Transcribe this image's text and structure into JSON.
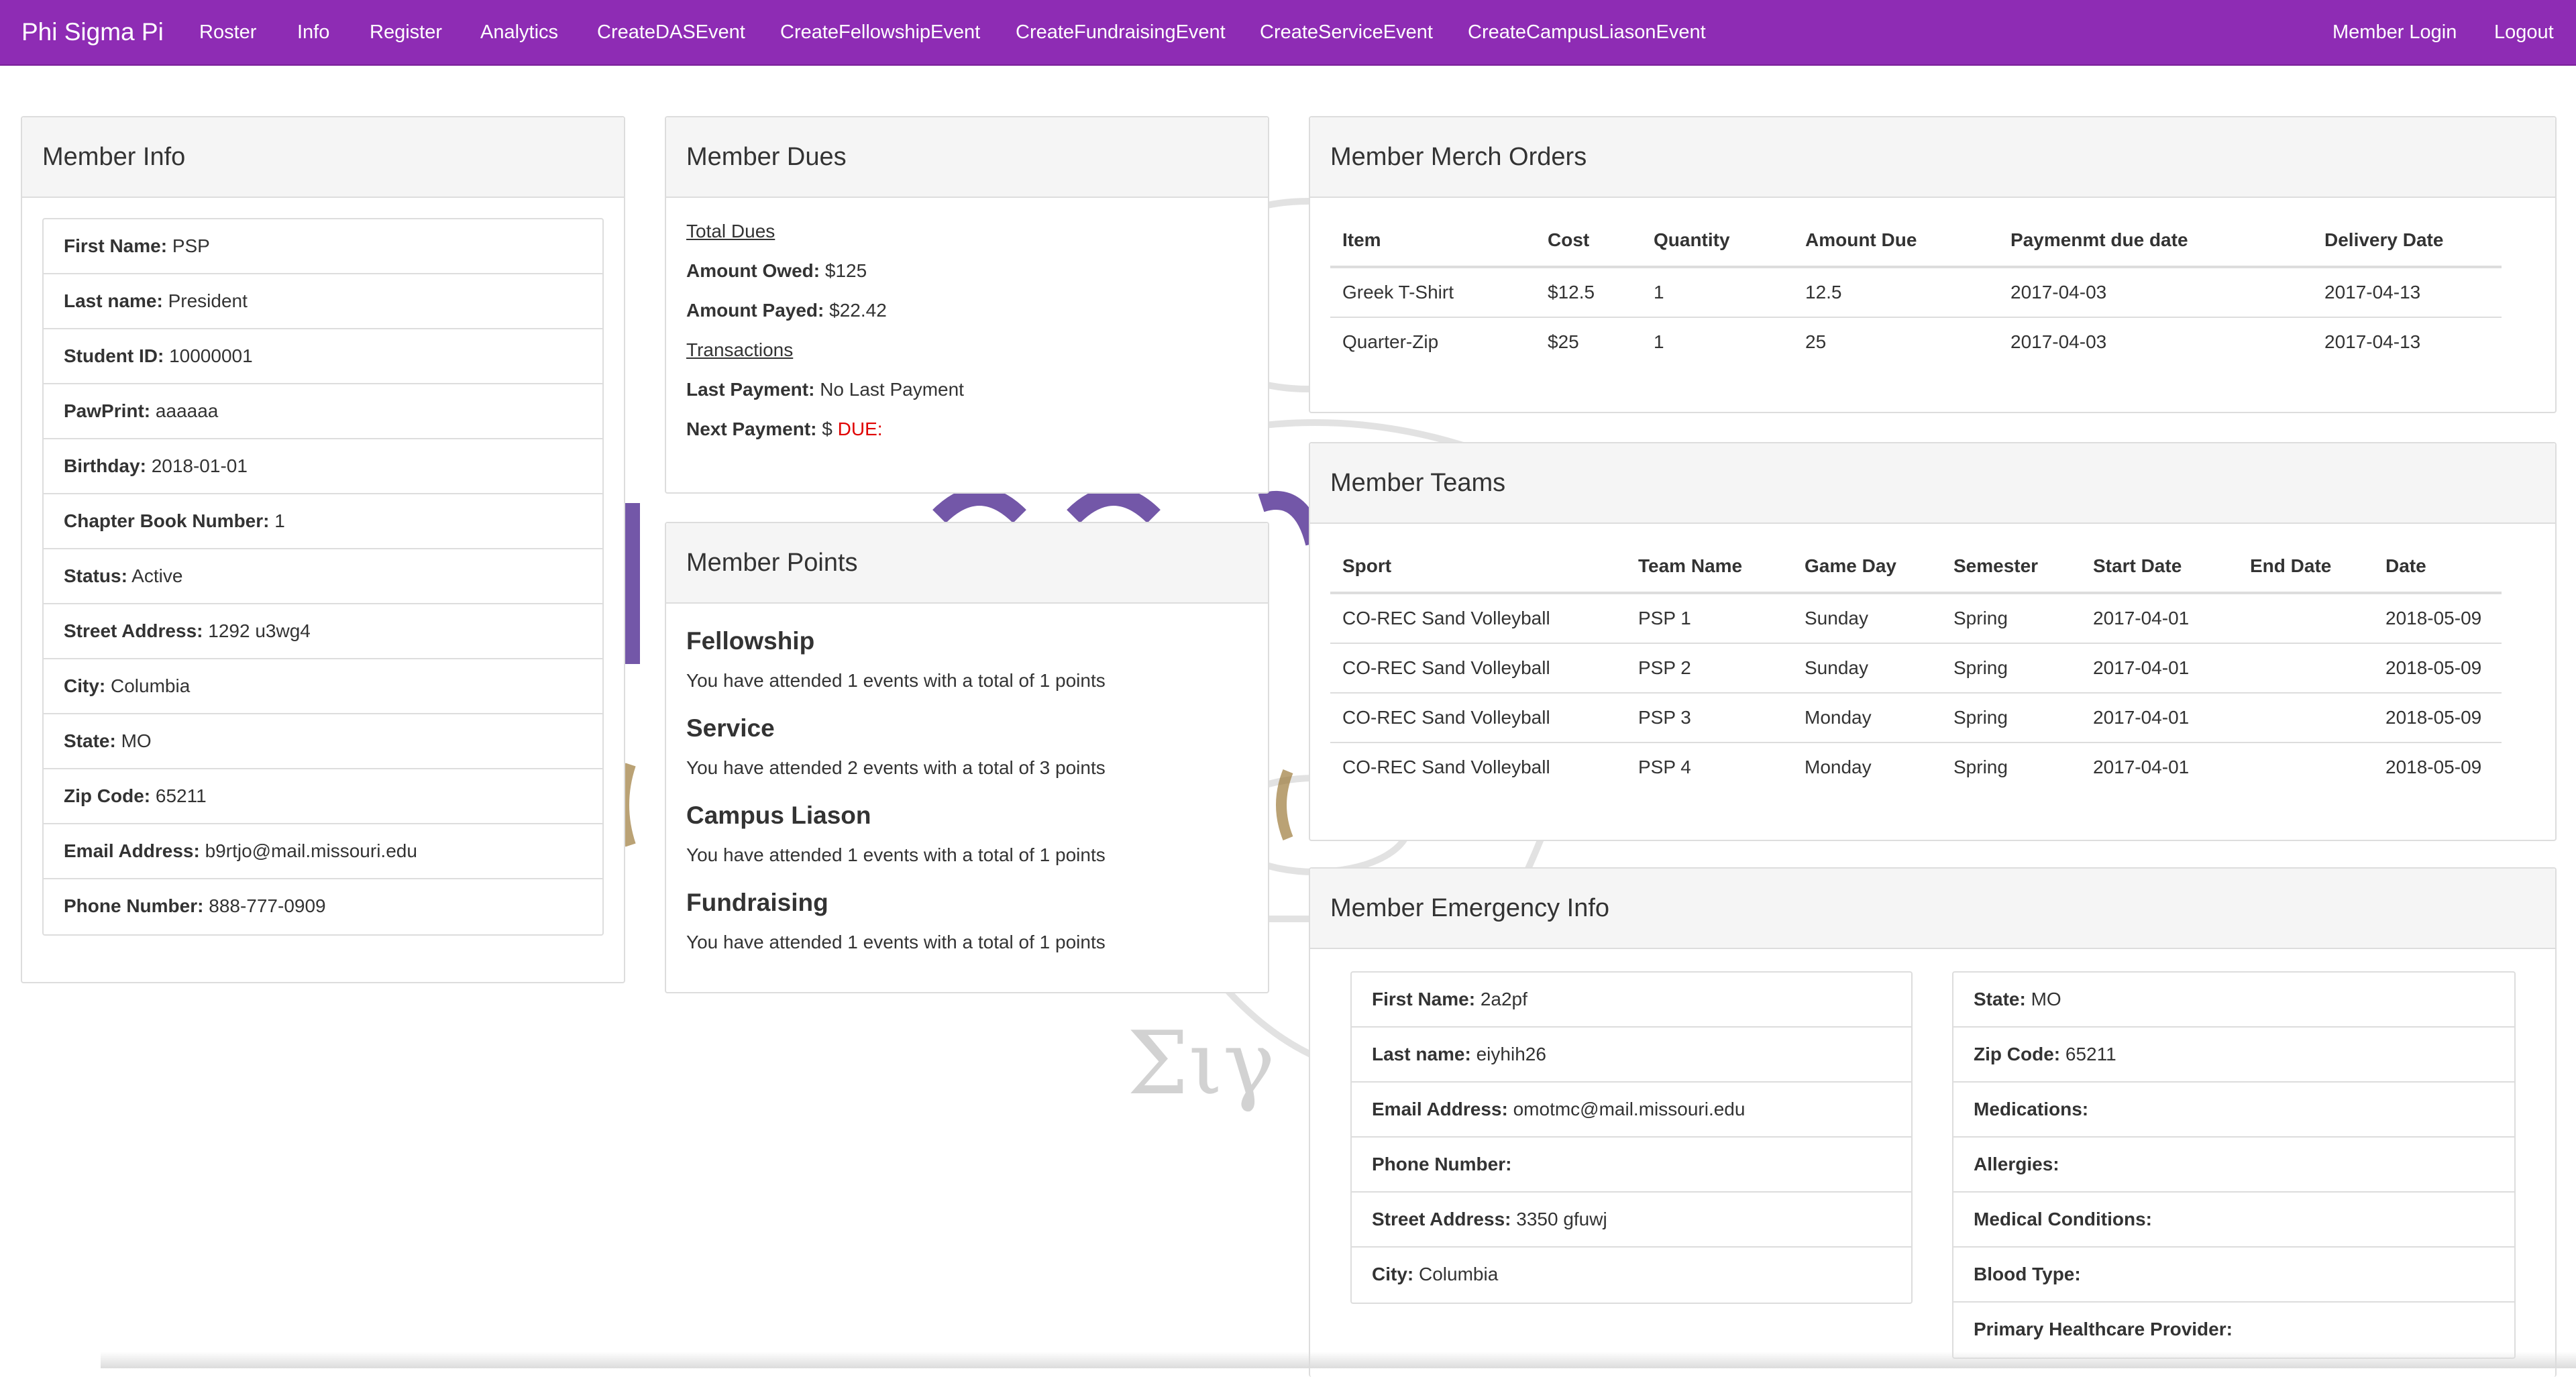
{
  "navbar": {
    "brand": "Phi Sigma Pi",
    "items": [
      "Roster",
      "Info",
      "Register",
      "Analytics",
      "CreateDASEvent",
      "CreateFellowshipEvent",
      "CreateFundraisingEvent",
      "CreateServiceEvent",
      "CreateCampusLiasonEvent"
    ],
    "right_items": [
      "Member Login",
      "Logout"
    ],
    "color": "#8e2cb4"
  },
  "member_info": {
    "title": "Member Info",
    "rows": [
      {
        "label": "First Name:",
        "value": "PSP"
      },
      {
        "label": "Last name:",
        "value": "President"
      },
      {
        "label": "Student ID:",
        "value": "10000001"
      },
      {
        "label": "PawPrint:",
        "value": "aaaaaa"
      },
      {
        "label": "Birthday:",
        "value": "2018-01-01"
      },
      {
        "label": "Chapter Book Number:",
        "value": "1"
      },
      {
        "label": "Status:",
        "value": "Active"
      },
      {
        "label": "Street Address:",
        "value": "1292 u3wg4"
      },
      {
        "label": "City:",
        "value": "Columbia"
      },
      {
        "label": "State:",
        "value": "MO"
      },
      {
        "label": "Zip Code:",
        "value": "65211"
      },
      {
        "label": "Email Address:",
        "value": "b9rtjo@mail.missouri.edu"
      },
      {
        "label": "Phone Number:",
        "value": "888-777-0909"
      }
    ]
  },
  "member_dues": {
    "title": "Member Dues",
    "total_dues": "Total Dues",
    "amount_owed_label": "Amount Owed:",
    "amount_owed": "$125",
    "amount_payed_label": "Amount Payed:",
    "amount_payed": "$22.42",
    "transactions": "Transactions",
    "last_payment_label": "Last Payment:",
    "last_payment": "No Last Payment",
    "next_payment_label": "Next Payment:",
    "next_payment": "$",
    "due": "DUE:",
    "due_color": "#e00000"
  },
  "member_points": {
    "title": "Member Points",
    "categories": [
      {
        "name": "Fellowship",
        "text": "You have attended 1 events with a total of 1 points"
      },
      {
        "name": "Service",
        "text": "You have attended 2 events with a total of 3 points"
      },
      {
        "name": "Campus Liason",
        "text": "You have attended 1 events with a total of 1 points"
      },
      {
        "name": "Fundraising",
        "text": "You have attended 1 events with a total of 1 points"
      }
    ]
  },
  "merch_orders": {
    "title": "Member Merch Orders",
    "columns": [
      "Item",
      "Cost",
      "Quantity",
      "Amount Due",
      "Paymenmt due date",
      "Delivery Date"
    ],
    "rows": [
      [
        "Greek T-Shirt",
        "$12.5",
        "1",
        "12.5",
        "2017-04-03",
        "2017-04-13"
      ],
      [
        "Quarter-Zip",
        "$25",
        "1",
        "25",
        "2017-04-03",
        "2017-04-13"
      ]
    ]
  },
  "teams": {
    "title": "Member Teams",
    "columns": [
      "Sport",
      "Team Name",
      "Game Day",
      "Semester",
      "Start Date",
      "End Date",
      "Date"
    ],
    "rows": [
      [
        "CO-REC Sand Volleyball",
        "PSP 1",
        "Sunday",
        "Spring",
        "2017-04-01",
        "",
        "2018-05-09"
      ],
      [
        "CO-REC Sand Volleyball",
        "PSP 2",
        "Sunday",
        "Spring",
        "2017-04-01",
        "",
        "2018-05-09"
      ],
      [
        "CO-REC Sand Volleyball",
        "PSP 3",
        "Monday",
        "Spring",
        "2017-04-01",
        "",
        "2018-05-09"
      ],
      [
        "CO-REC Sand Volleyball",
        "PSP 4",
        "Monday",
        "Spring",
        "2017-04-01",
        "",
        "2018-05-09"
      ]
    ]
  },
  "emergency": {
    "title": "Member Emergency Info",
    "left": [
      {
        "label": "First Name:",
        "value": "2a2pf"
      },
      {
        "label": "Last name:",
        "value": "eiyhih26"
      },
      {
        "label": "Email Address:",
        "value": "omotmc@mail.missouri.edu"
      },
      {
        "label": "Phone Number:",
        "value": ""
      },
      {
        "label": "Street Address:",
        "value": "3350 gfuwj"
      },
      {
        "label": "City:",
        "value": "Columbia"
      }
    ],
    "right": [
      {
        "label": "State:",
        "value": "MO"
      },
      {
        "label": "Zip Code:",
        "value": "65211"
      },
      {
        "label": "Medications:",
        "value": ""
      },
      {
        "label": "Allergies:",
        "value": ""
      },
      {
        "label": "Medical Conditions:",
        "value": ""
      },
      {
        "label": "Blood Type:",
        "value": ""
      },
      {
        "label": "Primary Healthcare Provider:",
        "value": ""
      }
    ]
  }
}
